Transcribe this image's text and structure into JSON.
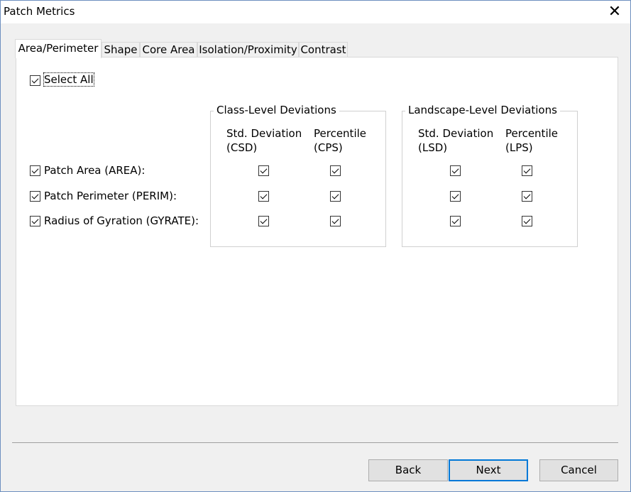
{
  "window": {
    "title": "Patch Metrics",
    "close_icon": "close-icon"
  },
  "tabs": [
    {
      "label": "Area/Perimeter",
      "active": true
    },
    {
      "label": "Shape",
      "active": false
    },
    {
      "label": "Core Area",
      "active": false
    },
    {
      "label": "Isolation/Proximity",
      "active": false
    },
    {
      "label": "Contrast",
      "active": false
    }
  ],
  "select_all": {
    "label": "Select All",
    "checked": true
  },
  "class_group": {
    "title": "Class-Level Deviations",
    "col1": {
      "line1": "Std. Deviation",
      "line2": "(CSD)"
    },
    "col2": {
      "line1": "Percentile",
      "line2": "(CPS)"
    }
  },
  "landscape_group": {
    "title": "Landscape-Level Deviations",
    "col1": {
      "line1": "Std. Deviation",
      "line2": "(LSD)"
    },
    "col2": {
      "line1": "Percentile",
      "line2": "(LPS)"
    }
  },
  "metrics": [
    {
      "label": "Patch Area (AREA):",
      "checked": true,
      "csd": true,
      "cps": true,
      "lsd": true,
      "lps": true
    },
    {
      "label": "Patch Perimeter (PERIM):",
      "checked": true,
      "csd": true,
      "cps": true,
      "lsd": true,
      "lps": true
    },
    {
      "label": "Radius of Gyration (GYRATE):",
      "checked": true,
      "csd": true,
      "cps": true,
      "lsd": true,
      "lps": true
    }
  ],
  "buttons": {
    "back": "Back",
    "next": "Next",
    "cancel": "Cancel"
  }
}
